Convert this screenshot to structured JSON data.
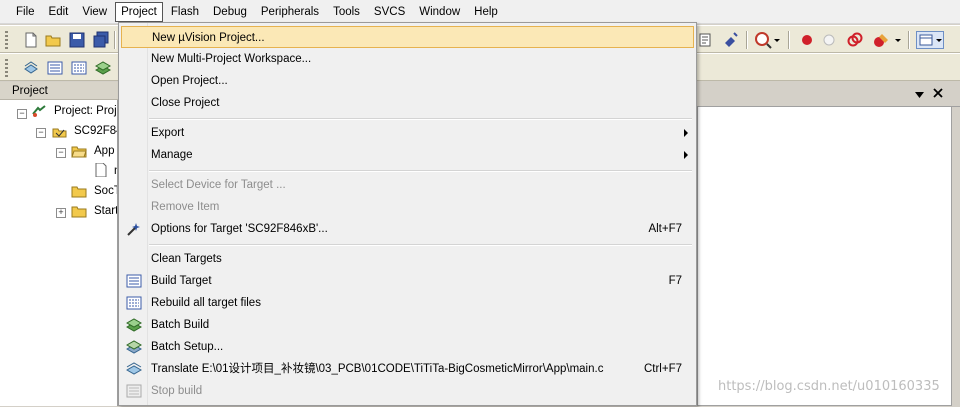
{
  "menubar": {
    "items": [
      "File",
      "Edit",
      "View",
      "Project",
      "Flash",
      "Debug",
      "Peripherals",
      "Tools",
      "SVCS",
      "Window",
      "Help"
    ],
    "active": "Project"
  },
  "project_panel": {
    "title": "Project",
    "tree": [
      {
        "label": "Project: Proj",
        "level": 0,
        "expanded": true
      },
      {
        "label": "SC92F84",
        "level": 1,
        "expanded": true
      },
      {
        "label": "App",
        "level": 2,
        "expanded": true
      },
      {
        "label": "n",
        "level": 3
      },
      {
        "label": "SocT",
        "level": 2
      },
      {
        "label": "Start",
        "level": 2,
        "expanded": false
      }
    ]
  },
  "project_menu": {
    "items": [
      {
        "label": "New µVision Project...",
        "highlighted": true
      },
      {
        "label": "New Multi-Project Workspace..."
      },
      {
        "label": "Open Project..."
      },
      {
        "label": "Close Project"
      },
      {
        "label": "Export",
        "submenu": true
      },
      {
        "label": "Manage",
        "submenu": true
      },
      {
        "label": "Select Device for Target ...",
        "disabled": true
      },
      {
        "label": "Remove Item",
        "disabled": true
      },
      {
        "label": "Options for Target 'SC92F846xB'...",
        "shortcut": "Alt+F7",
        "icon": "options-wand-icon"
      },
      {
        "label": "Clean Targets"
      },
      {
        "label": "Build Target",
        "shortcut": "F7",
        "icon": "build-target-icon"
      },
      {
        "label": "Rebuild all target files",
        "icon": "rebuild-icon"
      },
      {
        "label": "Batch Build",
        "icon": "batch-build-icon"
      },
      {
        "label": "Batch Setup...",
        "icon": "batch-setup-icon"
      },
      {
        "label": "Translate E:\\01设计项目_补妆镜\\03_PCB\\01CODE\\TiTiTa-BigCosmeticMirror\\App\\main.c",
        "shortcut": "Ctrl+F7",
        "icon": "translate-icon"
      },
      {
        "label": "Stop build",
        "disabled": true,
        "icon": "stop-build-icon"
      }
    ]
  },
  "editor": {
    "watermark": "https://blog.csdn.net/u010160335"
  },
  "colors": {
    "menu_highlight": "#fbe8b6",
    "menu_highlight_border": "#e6b24f",
    "disabled_text": "#8d8d8d"
  }
}
